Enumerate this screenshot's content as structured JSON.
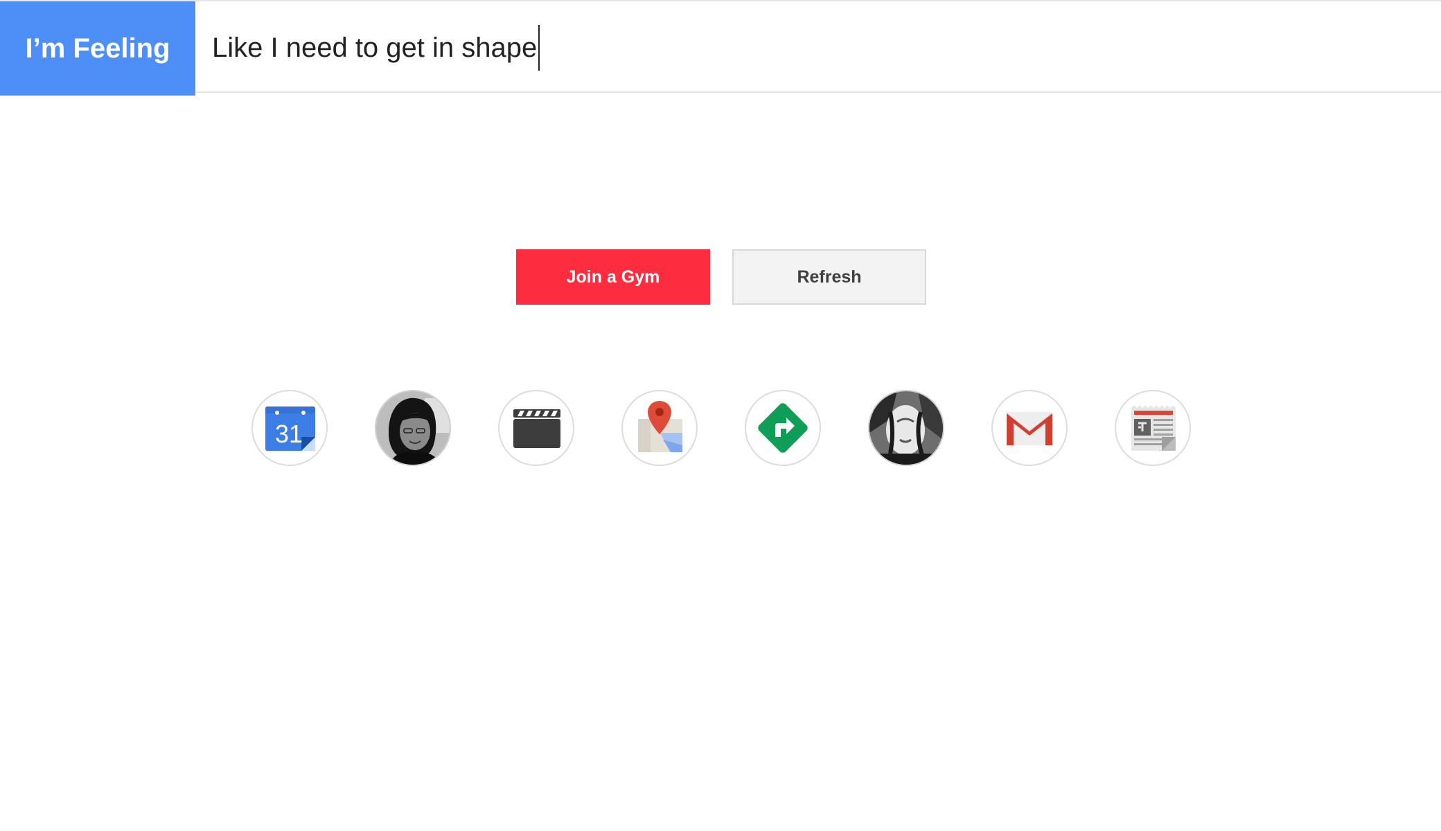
{
  "header": {
    "brand": "I’m Feeling",
    "query": "Like I need to get in shape"
  },
  "actions": {
    "primary_label": "Join a Gym",
    "secondary_label": "Refresh"
  },
  "calendar_day": "31",
  "colors": {
    "brand_bg": "#4d8ef7",
    "primary_button": "#fb2d3f",
    "secondary_button": "#f3f3f3"
  },
  "apps": [
    {
      "icon": "calendar-icon"
    },
    {
      "icon": "avatar-photo"
    },
    {
      "icon": "clapperboard-icon"
    },
    {
      "icon": "maps-icon"
    },
    {
      "icon": "directions-icon"
    },
    {
      "icon": "photo-thumbnail"
    },
    {
      "icon": "gmail-icon"
    },
    {
      "icon": "news-icon"
    }
  ]
}
